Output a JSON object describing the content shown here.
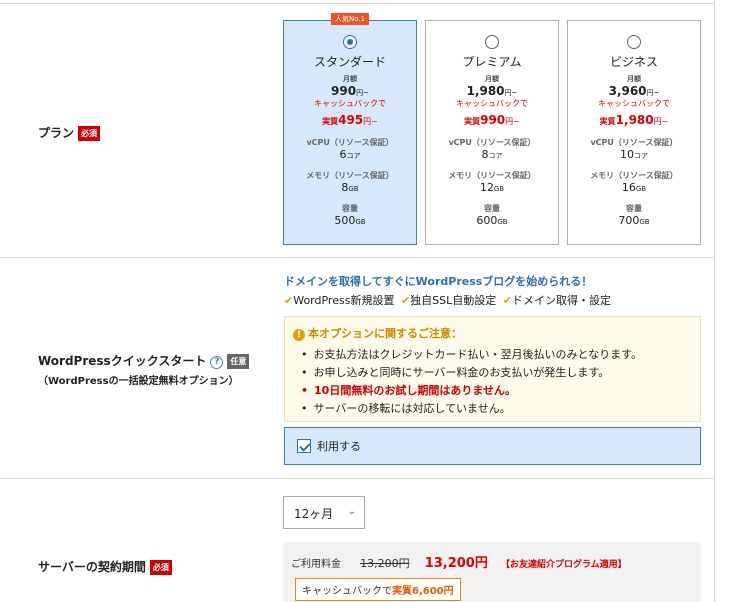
{
  "plan_section": {
    "label": "プラン",
    "required": "必須",
    "plans": [
      {
        "badge": "人気No.1",
        "name": "スタンダード",
        "price_label": "月額",
        "price": "990",
        "price_unit": "円~",
        "cashback_label": "キャッシュバックで",
        "effective_prefix": "実質",
        "effective_price": "495",
        "effective_unit": "円~",
        "vcpu_label": "vCPU（リソース保証）",
        "vcpu_value": "6",
        "vcpu_unit": "コア",
        "memory_label": "メモリ（リソース保証）",
        "memory_value": "8",
        "memory_unit": "GB",
        "storage_label": "容量",
        "storage_value": "500",
        "storage_unit": "GB",
        "selected": true
      },
      {
        "badge": "",
        "name": "プレミアム",
        "price_label": "月額",
        "price": "1,980",
        "price_unit": "円~",
        "cashback_label": "キャッシュバックで",
        "effective_prefix": "実質",
        "effective_price": "990",
        "effective_unit": "円~",
        "vcpu_label": "vCPU（リソース保証）",
        "vcpu_value": "8",
        "vcpu_unit": "コア",
        "memory_label": "メモリ（リソース保証）",
        "memory_value": "12",
        "memory_unit": "GB",
        "storage_label": "容量",
        "storage_value": "600",
        "storage_unit": "GB",
        "selected": false
      },
      {
        "badge": "",
        "name": "ビジネス",
        "price_label": "月額",
        "price": "3,960",
        "price_unit": "円~",
        "cashback_label": "キャッシュバックで",
        "effective_prefix": "実質",
        "effective_price": "1,980",
        "effective_unit": "円~",
        "vcpu_label": "vCPU（リソース保証）",
        "vcpu_value": "10",
        "vcpu_unit": "コア",
        "memory_label": "メモリ（リソース保証）",
        "memory_value": "16",
        "memory_unit": "GB",
        "storage_label": "容量",
        "storage_value": "700",
        "storage_unit": "GB",
        "selected": false
      }
    ]
  },
  "wp_section": {
    "label": "WordPressクイックスタート",
    "help_icon": "?",
    "optional": "任意",
    "sublabel": "（WordPressの一括設定無料オプション）",
    "headline": "ドメインを取得してすぐにWordPressブログを始められる！",
    "features": [
      "WordPress新規設置",
      "独自SSL自動設定",
      "ドメイン取得・設定"
    ],
    "notice_title": "本オプションに関するご注意：",
    "notice_items": [
      "お支払方法はクレジットカード払い・翌月後払いのみとなります。",
      "お申し込みと同時にサーバー料金のお支払いが発生します。",
      "10日間無料のお試し期間はありません。",
      "サーバーの移転には対応していません。"
    ],
    "use_label": "利用する",
    "use_checked": true
  },
  "term_section": {
    "label": "サーバーの契約期間",
    "required": "必須",
    "select_value": "12ヶ月",
    "fee_label": "ご利用料金",
    "original_price": "13,200円",
    "discount_price": "13,200円",
    "promo_note": "【お友達紹介プログラム適用】",
    "cashback_text": "キャッシュバックで",
    "cashback_amount": "実質6,600円"
  },
  "colors": {
    "accent": "#3a7bd5",
    "selected_bg": "#d6e8fa",
    "required": "#cc0000",
    "warning": "#e6a000"
  }
}
